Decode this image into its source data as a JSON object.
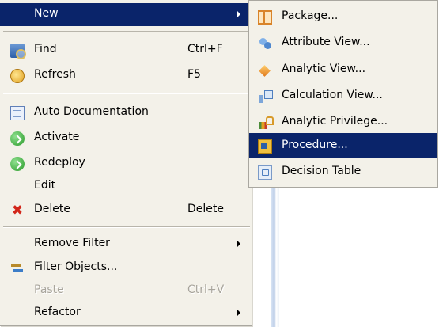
{
  "menu": {
    "new": {
      "label": "New"
    },
    "find": {
      "label": "Find",
      "shortcut": "Ctrl+F",
      "icon": "find-icon"
    },
    "refresh": {
      "label": "Refresh",
      "shortcut": "F5",
      "icon": "refresh-icon"
    },
    "auto_documentation": {
      "label": "Auto Documentation",
      "icon": "document-icon"
    },
    "activate": {
      "label": "Activate",
      "icon": "activate-icon"
    },
    "redeploy": {
      "label": "Redeploy",
      "icon": "redeploy-icon"
    },
    "edit": {
      "label": "Edit"
    },
    "delete": {
      "label": "Delete",
      "shortcut": "Delete",
      "icon": "delete-icon"
    },
    "remove_filter": {
      "label": "Remove Filter"
    },
    "filter_objects": {
      "label": "Filter Objects...",
      "icon": "filter-icon"
    },
    "paste": {
      "label": "Paste",
      "shortcut": "Ctrl+V"
    },
    "refactor": {
      "label": "Refactor"
    }
  },
  "submenu": {
    "items": [
      {
        "label": "Package...",
        "icon": "package-icon"
      },
      {
        "label": "Attribute View...",
        "icon": "attribute-view-icon"
      },
      {
        "label": "Analytic View...",
        "icon": "analytic-view-icon"
      },
      {
        "label": "Calculation View...",
        "icon": "calculation-view-icon"
      },
      {
        "label": "Analytic Privilege...",
        "icon": "analytic-privilege-icon"
      },
      {
        "label": "Procedure...",
        "icon": "procedure-icon"
      },
      {
        "label": "Decision Table",
        "icon": "decision-table-icon"
      }
    ]
  },
  "colors": {
    "menu_background": "#f3f1e9",
    "selection": "#0a246a",
    "disabled_text": "#a8a59c",
    "delete_icon": "#d2261a"
  }
}
